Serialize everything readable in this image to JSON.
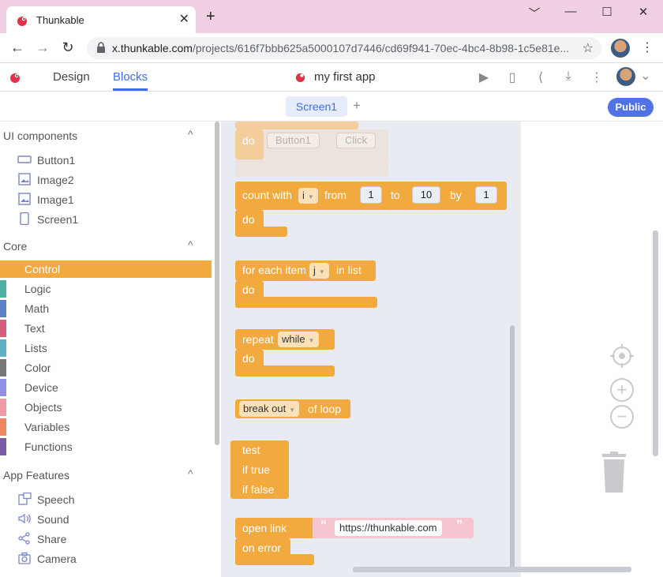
{
  "browser": {
    "tab_title": "Thunkable",
    "url_host": "x.thunkable.com",
    "url_path": "/projects/616f7bbb625a5000107d7446/cd69f941-70ec-4bc4-8b98-1c5e81e...",
    "new_tab": "+",
    "tab_close": "✕",
    "min": "﹀",
    "restore": "—",
    "max": "☐",
    "close": "✕",
    "back": "←",
    "forward": "→",
    "reload": "↻",
    "star": "☆",
    "menu": "⋮"
  },
  "app": {
    "tabs": [
      "Design",
      "Blocks"
    ],
    "active_tab": "Blocks",
    "project_title": "my first app",
    "icons": [
      "play-icon",
      "device-icon",
      "share-icon",
      "download-icon",
      "more-icon"
    ],
    "play": "▶",
    "device": "▯",
    "share": "⟨",
    "download": "⤓",
    "more": "⋮",
    "avatar_chevron": "⌄"
  },
  "screenbar": {
    "screen_tab": "Screen1",
    "add": "+",
    "public_label": "Public"
  },
  "sidebar": {
    "ui_components_title": "UI components",
    "components": [
      "Button1",
      "Image2",
      "Image1",
      "Screen1"
    ],
    "core_title": "Core",
    "categories": [
      {
        "label": "Control",
        "color": "#f2a93d"
      },
      {
        "label": "Logic",
        "color": "#4cb1a1"
      },
      {
        "label": "Math",
        "color": "#5c81c4"
      },
      {
        "label": "Text",
        "color": "#d95c7c"
      },
      {
        "label": "Lists",
        "color": "#5eb1c4"
      },
      {
        "label": "Color",
        "color": "#777777"
      },
      {
        "label": "Device",
        "color": "#8f8fe6"
      },
      {
        "label": "Objects",
        "color": "#ef9aa6"
      },
      {
        "label": "Variables",
        "color": "#f08660"
      },
      {
        "label": "Functions",
        "color": "#7a5ba6"
      }
    ],
    "app_features_title": "App Features",
    "features": [
      "Speech",
      "Sound",
      "Share",
      "Camera"
    ],
    "caret": "^"
  },
  "blocks": {
    "event_do": "do",
    "event_component": "Button1",
    "event_action": "Click",
    "count_with": "count with",
    "count_var": "i",
    "from": "from",
    "from_val": "1",
    "to": "to",
    "to_val": "10",
    "by": "by",
    "by_val": "1",
    "do": "do",
    "for_each_item": "for each item",
    "each_var": "j",
    "in_list": "in list",
    "repeat": "repeat",
    "repeat_mode": "while",
    "break_out": "break out",
    "of_loop": "of loop",
    "test": "test",
    "if_true": "if true",
    "if_false": "if false",
    "open_link": "open link",
    "on_error": "on error",
    "link_value": "https://thunkable.com",
    "open_quote": "“",
    "close_quote": "”"
  },
  "workspace_controls": {
    "zoom_in": "+",
    "zoom_out": "−"
  }
}
